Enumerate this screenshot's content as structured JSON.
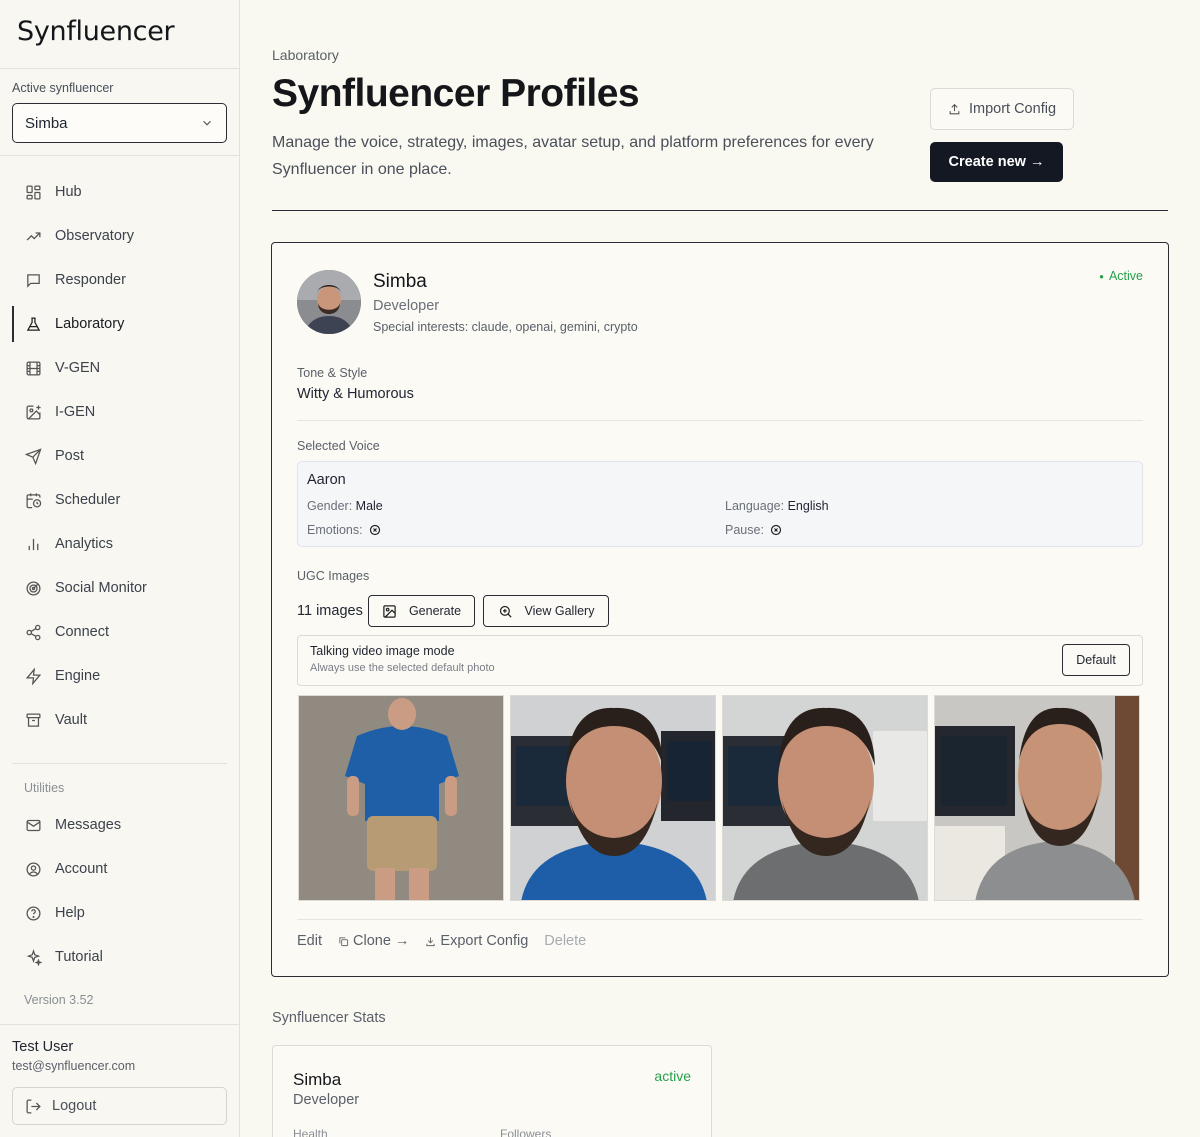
{
  "app": {
    "logo": "Synfluencer",
    "version": "Version 3.52"
  },
  "sidebar": {
    "active_label": "Active synfluencer",
    "active_value": "Simba",
    "nav": [
      {
        "label": "Hub",
        "icon": "grid-icon"
      },
      {
        "label": "Observatory",
        "icon": "trend-icon"
      },
      {
        "label": "Responder",
        "icon": "chat-icon"
      },
      {
        "label": "Laboratory",
        "icon": "flask-icon"
      },
      {
        "label": "V-GEN",
        "icon": "film-icon"
      },
      {
        "label": "I-GEN",
        "icon": "image-plus-icon"
      },
      {
        "label": "Post",
        "icon": "send-icon"
      },
      {
        "label": "Scheduler",
        "icon": "calendar-clock-icon"
      },
      {
        "label": "Analytics",
        "icon": "bar-chart-icon"
      },
      {
        "label": "Social Monitor",
        "icon": "radar-icon"
      },
      {
        "label": "Connect",
        "icon": "share-icon"
      },
      {
        "label": "Engine",
        "icon": "bolt-icon"
      },
      {
        "label": "Vault",
        "icon": "archive-icon"
      }
    ],
    "utilities_label": "Utilities",
    "utilities": [
      {
        "label": "Messages",
        "icon": "mail-icon"
      },
      {
        "label": "Account",
        "icon": "user-circle-icon"
      },
      {
        "label": "Help",
        "icon": "help-icon"
      },
      {
        "label": "Tutorial",
        "icon": "sparkles-icon"
      }
    ],
    "user": {
      "name": "Test User",
      "email": "test@synfluencer.com"
    },
    "logout_label": "Logout"
  },
  "header": {
    "breadcrumb": "Laboratory",
    "title": "Synfluencer Profiles",
    "description": "Manage the voice, strategy, images, avatar setup, and platform preferences for every Synfluencer in one place.",
    "import_label": "Import Config",
    "create_label": "Create new →"
  },
  "profile": {
    "name": "Simba",
    "role": "Developer",
    "interests": "Special interests: claude, openai, gemini, crypto",
    "status": "Active",
    "tone_label": "Tone & Style",
    "tone_value": "Witty & Humorous",
    "voice_label": "Selected Voice",
    "voice": {
      "name": "Aaron",
      "gender_label": "Gender:",
      "gender": "Male",
      "language_label": "Language:",
      "language": "English",
      "emotions_label": "Emotions:",
      "pause_label": "Pause:"
    },
    "ugc_label": "UGC Images",
    "image_count": "11 images",
    "generate_label": "Generate",
    "gallery_label": "View Gallery",
    "mode_title": "Talking video image mode",
    "mode_sub": "Always use the selected default photo",
    "mode_btn": "Default",
    "actions": {
      "edit": "Edit",
      "clone": "Clone →",
      "export": "Export Config",
      "delete": "Delete"
    }
  },
  "stats": {
    "label": "Synfluencer Stats",
    "name": "Simba",
    "role": "Developer",
    "status": "active",
    "health_label": "Health",
    "followers_label": "Followers"
  },
  "colors": {
    "accent_dark": "#141823",
    "active_green": "#27a04e",
    "background": "#f9f8f1"
  }
}
